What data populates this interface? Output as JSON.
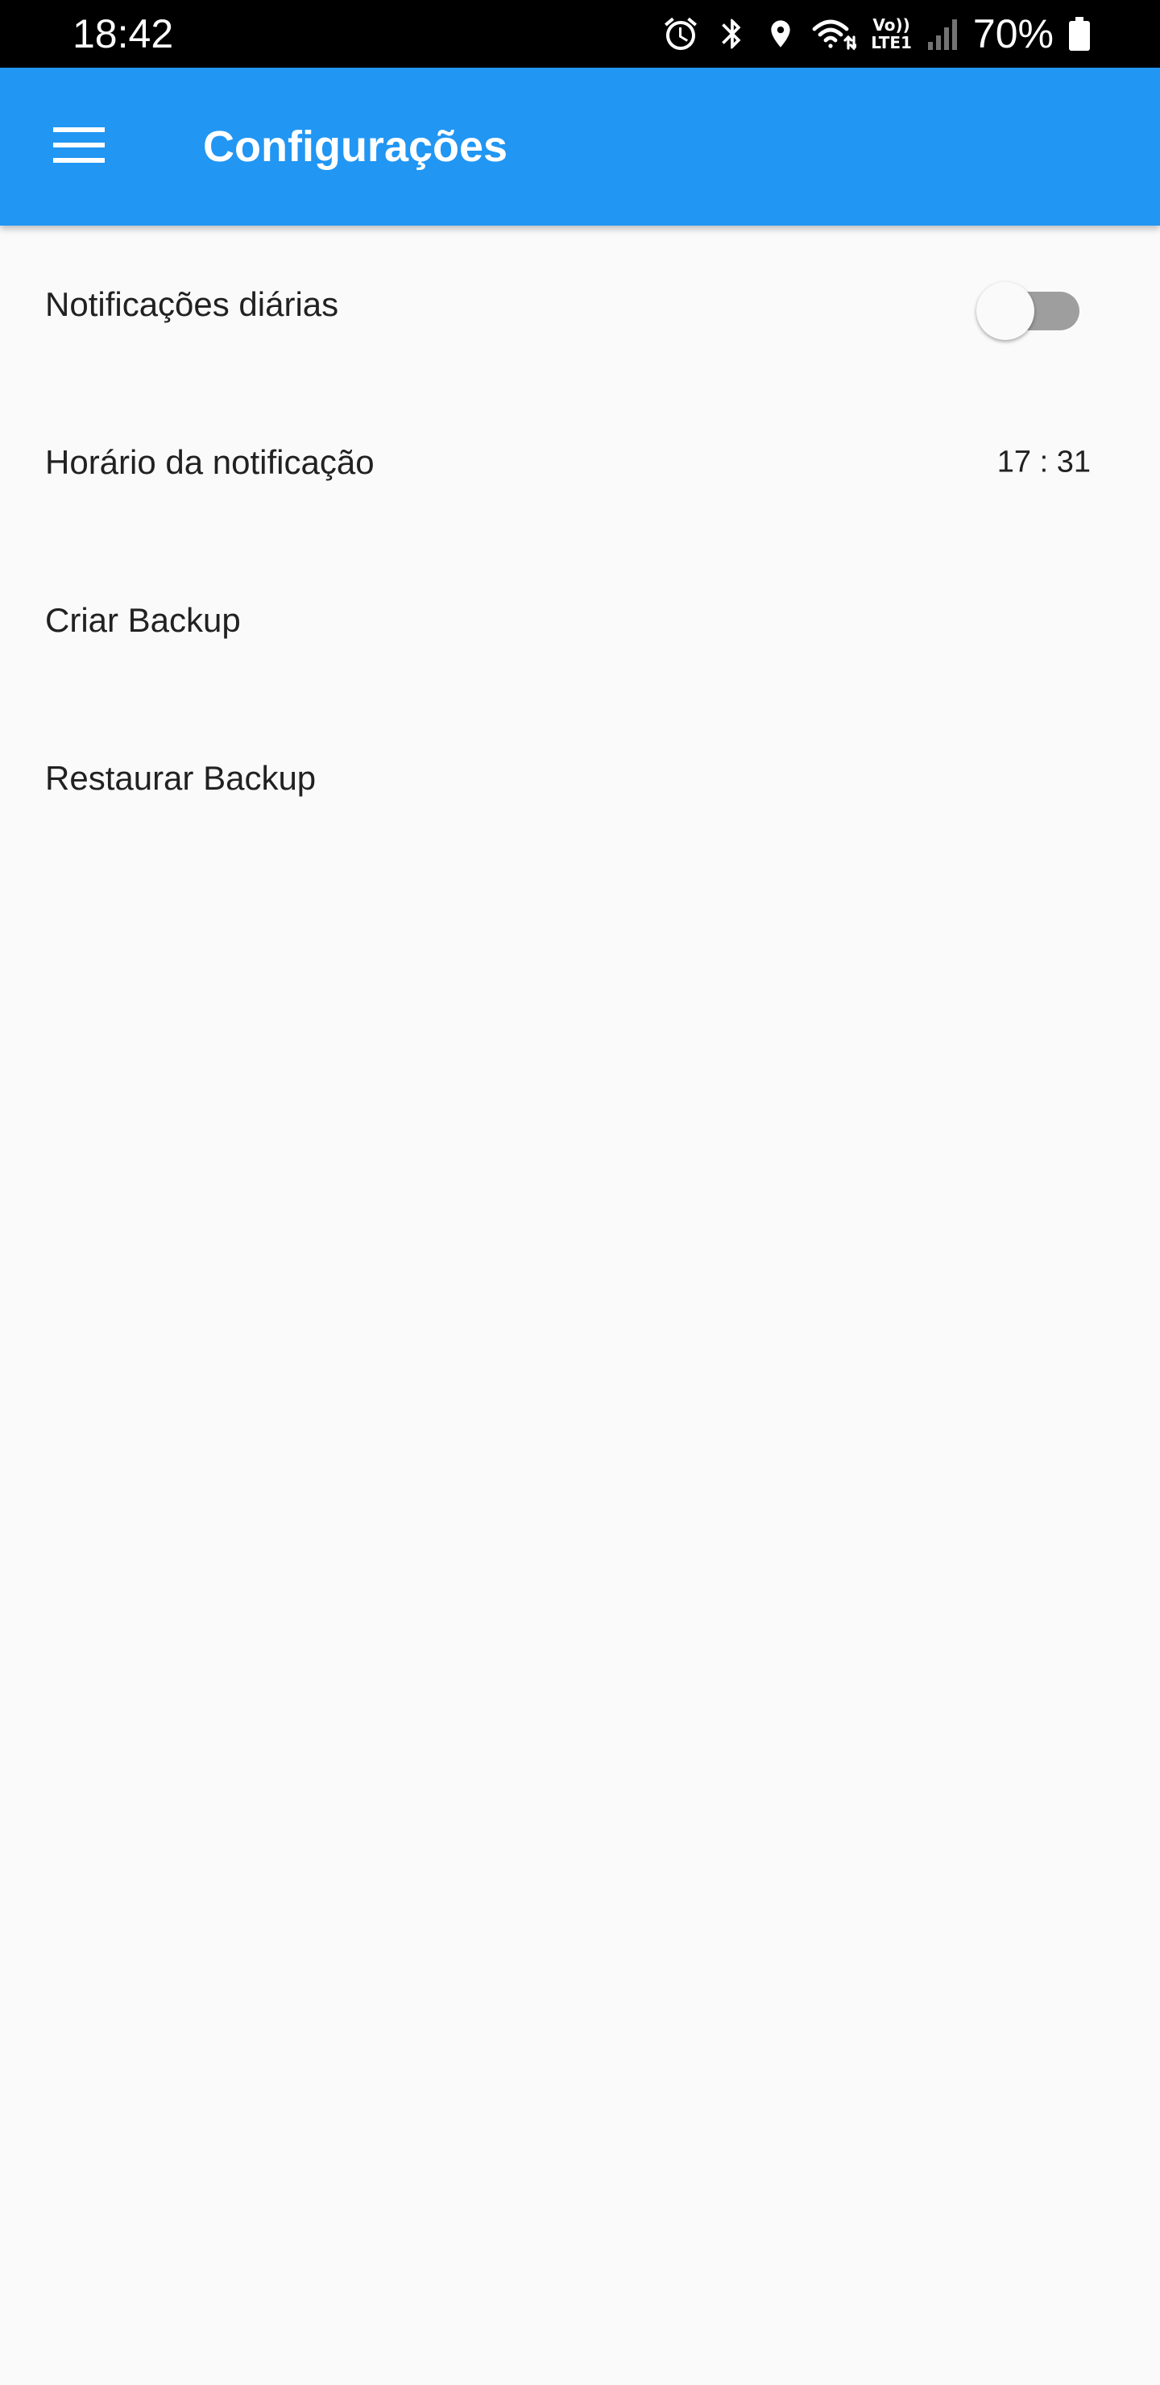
{
  "status_bar": {
    "time": "18:42",
    "icons": [
      "alarm-icon",
      "bluetooth-icon",
      "location-icon",
      "wifi-icon",
      "volte-lte-icon",
      "signal-icon",
      "battery-icon"
    ],
    "volte_top": "Vo))",
    "volte_bottom": "LTE1",
    "battery_percent": "70%"
  },
  "app_bar": {
    "title": "Configurações",
    "color": "#2196f3",
    "menu_icon": "hamburger-menu-icon"
  },
  "settings": {
    "daily_notifications": {
      "label": "Notificações diárias",
      "enabled": false
    },
    "notification_time": {
      "label": "Horário da notificação",
      "value": "17 : 31"
    },
    "create_backup": {
      "label": "Criar Backup"
    },
    "restore_backup": {
      "label": "Restaurar Backup"
    }
  }
}
